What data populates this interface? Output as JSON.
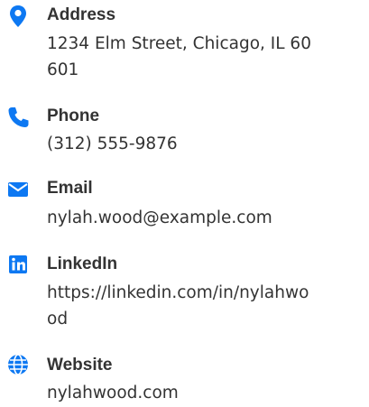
{
  "accent_color": "#0d78f2",
  "contacts": [
    {
      "icon": "map-pin-icon",
      "label": "Address",
      "value": "1234 Elm Street, Chicago, IL 60601"
    },
    {
      "icon": "phone-icon",
      "label": "Phone",
      "value": "(312) 555-9876"
    },
    {
      "icon": "envelope-icon",
      "label": "Email",
      "value": "nylah.wood@example.com"
    },
    {
      "icon": "linkedin-icon",
      "label": "LinkedIn",
      "value": "https://linkedin.com/in/nylahwood"
    },
    {
      "icon": "globe-icon",
      "label": "Website",
      "value": "nylahwood.com"
    }
  ]
}
